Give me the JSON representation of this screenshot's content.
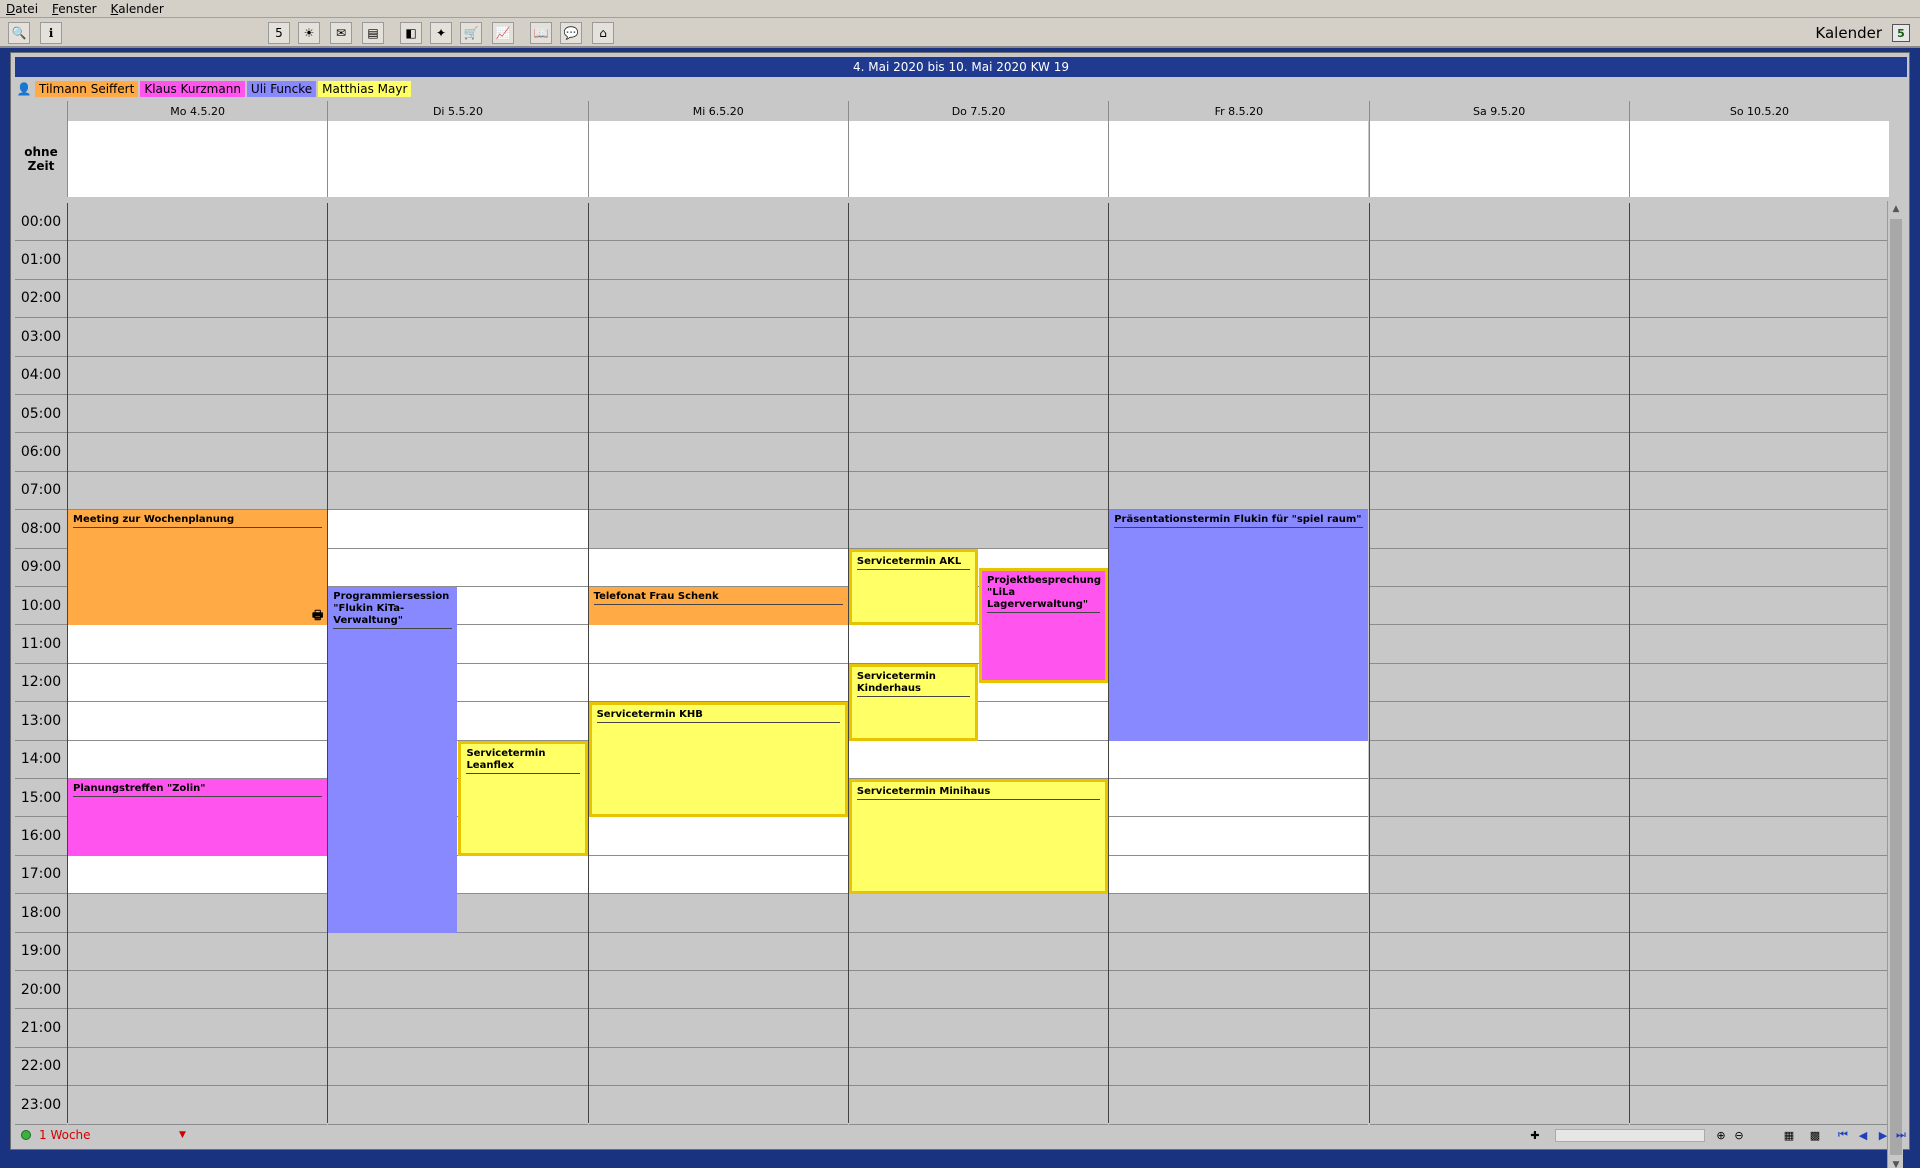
{
  "menu": [
    "Datei",
    "Fenster",
    "Kalender"
  ],
  "toolbar": {
    "title": "Kalender",
    "badge": "5",
    "left_icons": [
      "search-icon",
      "info-icon"
    ],
    "icons": [
      "calendar-5-icon",
      "sun-icon",
      "mail-icon",
      "display-icon",
      "window-icon",
      "star-icon",
      "cart-icon",
      "chart-icon",
      "book-icon",
      "speech-icon",
      "home-icon"
    ]
  },
  "week_label": "4. Mai 2020 bis 10. Mai 2020 KW 19",
  "users": [
    {
      "name": "Tilmann Seiffert",
      "color": "#ffaa44"
    },
    {
      "name": "Klaus Kurzmann",
      "color": "#ff55ee"
    },
    {
      "name": "Uli Funcke",
      "color": "#8888ff"
    },
    {
      "name": "Matthias Mayr",
      "color": "#ffff66"
    }
  ],
  "ohne_zeit": "ohne\nZeit",
  "days": [
    "Mo 4.5.20",
    "Di 5.5.20",
    "Mi 6.5.20",
    "Do 7.5.20",
    "Fr 8.5.20",
    "Sa 9.5.20",
    "So 10.5.20"
  ],
  "hours": [
    "00:00",
    "01:00",
    "02:00",
    "03:00",
    "04:00",
    "05:00",
    "06:00",
    "07:00",
    "08:00",
    "09:00",
    "10:00",
    "11:00",
    "12:00",
    "13:00",
    "14:00",
    "15:00",
    "16:00",
    "17:00",
    "18:00",
    "19:00",
    "20:00",
    "21:00",
    "22:00",
    "23:00"
  ],
  "work_hours": {
    "Mo 4.5.20": [
      8,
      18
    ],
    "Di 5.5.20": [
      8,
      18
    ],
    "Mi 6.5.20": [
      9,
      18
    ],
    "Do 7.5.20": [
      9,
      18
    ],
    "Fr 8.5.20": [
      8,
      18
    ],
    "Sa 9.5.20": null,
    "So 10.5.20": null
  },
  "events": [
    {
      "day": 0,
      "start": 8,
      "end": 11,
      "title": "Meeting zur Wochenplanung",
      "style": "ora",
      "col": 0,
      "cols": 1,
      "printer": true
    },
    {
      "day": 0,
      "start": 15,
      "end": 17,
      "title": "Planungstreffen \"Zolin\"",
      "style": "mag",
      "col": 0,
      "cols": 1
    },
    {
      "day": 1,
      "start": 10,
      "end": 19,
      "title": "Programmiersession \"Flukin KiTa-Verwaltung\"",
      "style": "blu",
      "col": 0,
      "cols": 2
    },
    {
      "day": 1,
      "start": 14,
      "end": 17,
      "title": "Servicetermin Leanflex",
      "style": "yel",
      "col": 1,
      "cols": 2
    },
    {
      "day": 2,
      "start": 10,
      "end": 11,
      "title": "Telefonat Frau Schenk",
      "style": "ora",
      "col": 0,
      "cols": 1
    },
    {
      "day": 2,
      "start": 13,
      "end": 16,
      "title": "Servicetermin KHB",
      "style": "yel",
      "col": 0,
      "cols": 1
    },
    {
      "day": 3,
      "start": 9,
      "end": 11,
      "title": "Servicetermin AKL",
      "style": "yel",
      "col": 0,
      "cols": 2
    },
    {
      "day": 3,
      "start": 9.5,
      "end": 12.5,
      "title": "Projektbesprechung \"LiLa Lagerverwaltung\"",
      "style": "magb",
      "col": 1,
      "cols": 2
    },
    {
      "day": 3,
      "start": 12,
      "end": 14,
      "title": "Servicetermin Kinderhaus",
      "style": "yel",
      "col": 0,
      "cols": 2
    },
    {
      "day": 3,
      "start": 15,
      "end": 18,
      "title": "Servicetermin Minihaus",
      "style": "yel",
      "col": 0,
      "cols": 1
    },
    {
      "day": 4,
      "start": 8,
      "end": 14,
      "title": "Präsentationstermin Flukin für \"spiel raum\"",
      "style": "blu",
      "col": 0,
      "cols": 1
    }
  ],
  "status": {
    "range_label": "1 Woche"
  },
  "nav_icons": [
    "add-icon",
    "zoom-in-icon",
    "zoom-out-icon",
    "grid-icon",
    "grid2-icon",
    "first-icon",
    "prev-icon",
    "next-icon",
    "last-icon"
  ]
}
